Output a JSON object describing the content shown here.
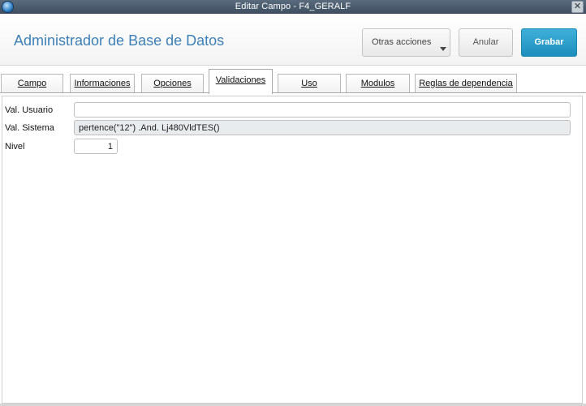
{
  "window": {
    "title": "Editar Campo - F4_GERALF",
    "close_glyph": "✕"
  },
  "header": {
    "title": "Administrador de Base de Datos",
    "buttons": {
      "otras": "Otras acciones",
      "anular": "Anular",
      "grabar": "Grabar"
    }
  },
  "tabs": [
    {
      "label": "Campo",
      "active": false
    },
    {
      "label": "Informaciones",
      "active": false
    },
    {
      "label": "Opciones",
      "active": false
    },
    {
      "label": "Validaciones",
      "active": true
    },
    {
      "label": "Uso",
      "active": false
    },
    {
      "label": "Modulos",
      "active": false
    },
    {
      "label": "Reglas de dependencia",
      "active": false
    }
  ],
  "form": {
    "val_usuario": {
      "label": "Val. Usuario",
      "value": ""
    },
    "val_sistema": {
      "label": "Val. Sistema",
      "value": "pertence(\"12\") .And. Lj480VldTES()"
    },
    "nivel": {
      "label": "Nivel",
      "value": "1"
    }
  },
  "colors": {
    "title_blue": "#3d80b6",
    "grabar_blue": "#1e8fbd",
    "readonly_bg": "#e9ecef"
  }
}
